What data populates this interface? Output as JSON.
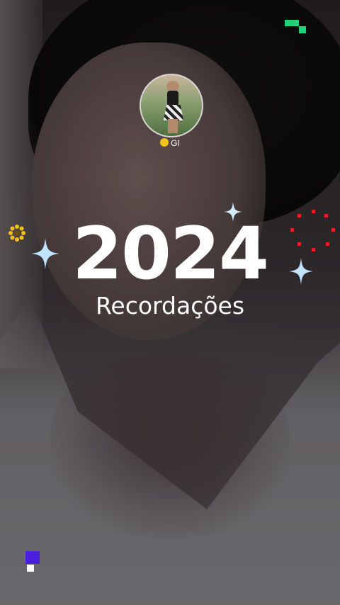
{
  "profile": {
    "username": "GI",
    "username_emoji": "smiling-face-emoji"
  },
  "recap": {
    "year": "2024",
    "subtitle": "Recordações"
  },
  "decorations": {
    "sparkle_color": "#bfe3ff",
    "pixel_green": "#1ed27a",
    "pixel_purple": "#4a1fe0",
    "dots_red": "#e0251f",
    "flower_yellow": "#f2c21a"
  }
}
